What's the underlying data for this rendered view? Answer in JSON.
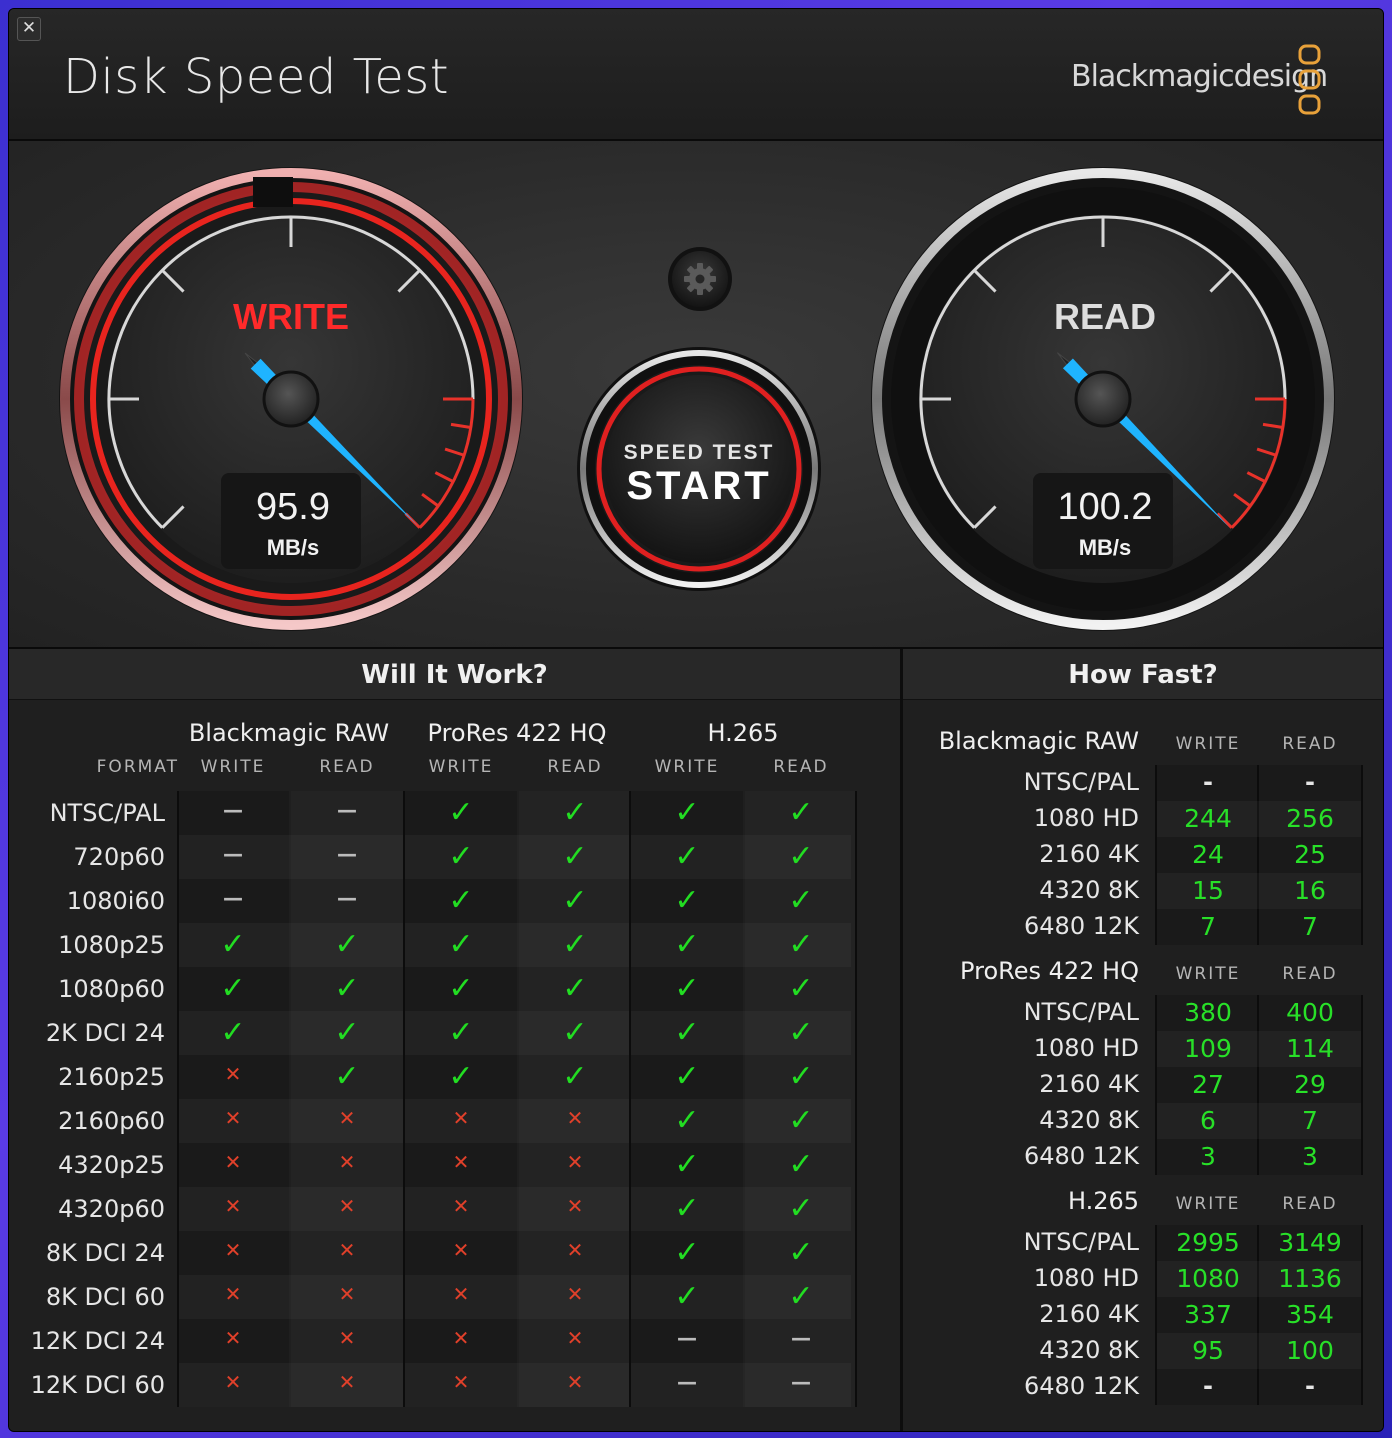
{
  "app": {
    "title": "Disk Speed Test",
    "brand": "Blackmagicdesign",
    "close_glyph": "✕"
  },
  "gauges": {
    "write": {
      "label": "WRITE",
      "value": "95.9",
      "unit": "MB/s",
      "speed_mbps": 95.9,
      "color": "#ff2a2a"
    },
    "read": {
      "label": "READ",
      "value": "100.2",
      "unit": "MB/s",
      "speed_mbps": 100.2,
      "color": "#d8d8d8"
    },
    "needle_color": "#1fb4ff",
    "settings_icon": "gear-icon"
  },
  "start_button": {
    "line1": "SPEED TEST",
    "line2": "START"
  },
  "will_it_work": {
    "title": "Will It Work?",
    "format_header": "FORMAT",
    "groups": [
      {
        "name": "Blackmagic RAW",
        "write": "WRITE",
        "read": "READ"
      },
      {
        "name": "ProRes 422 HQ",
        "write": "WRITE",
        "read": "READ"
      },
      {
        "name": "H.265",
        "write": "WRITE",
        "read": "READ"
      }
    ],
    "rows": [
      {
        "format": "NTSC/PAL",
        "cells": [
          "dash",
          "dash",
          "check",
          "check",
          "check",
          "check"
        ]
      },
      {
        "format": "720p60",
        "cells": [
          "dash",
          "dash",
          "check",
          "check",
          "check",
          "check"
        ]
      },
      {
        "format": "1080i60",
        "cells": [
          "dash",
          "dash",
          "check",
          "check",
          "check",
          "check"
        ]
      },
      {
        "format": "1080p25",
        "cells": [
          "check",
          "check",
          "check",
          "check",
          "check",
          "check"
        ]
      },
      {
        "format": "1080p60",
        "cells": [
          "check",
          "check",
          "check",
          "check",
          "check",
          "check"
        ]
      },
      {
        "format": "2K DCI 24",
        "cells": [
          "check",
          "check",
          "check",
          "check",
          "check",
          "check"
        ]
      },
      {
        "format": "2160p25",
        "cells": [
          "cross",
          "check",
          "check",
          "check",
          "check",
          "check"
        ]
      },
      {
        "format": "2160p60",
        "cells": [
          "cross",
          "cross",
          "cross",
          "cross",
          "check",
          "check"
        ]
      },
      {
        "format": "4320p25",
        "cells": [
          "cross",
          "cross",
          "cross",
          "cross",
          "check",
          "check"
        ]
      },
      {
        "format": "4320p60",
        "cells": [
          "cross",
          "cross",
          "cross",
          "cross",
          "check",
          "check"
        ]
      },
      {
        "format": "8K DCI 24",
        "cells": [
          "cross",
          "cross",
          "cross",
          "cross",
          "check",
          "check"
        ]
      },
      {
        "format": "8K DCI 60",
        "cells": [
          "cross",
          "cross",
          "cross",
          "cross",
          "check",
          "check"
        ]
      },
      {
        "format": "12K DCI 24",
        "cells": [
          "cross",
          "cross",
          "cross",
          "cross",
          "dash",
          "dash"
        ]
      },
      {
        "format": "12K DCI 60",
        "cells": [
          "cross",
          "cross",
          "cross",
          "cross",
          "dash",
          "dash"
        ]
      }
    ],
    "symbols": {
      "check": "✓",
      "cross": "✕",
      "dash": "—"
    },
    "colors": {
      "check": "#22dd22",
      "cross": "#e0402a",
      "dash": "#bcbcbc"
    }
  },
  "how_fast": {
    "title": "How Fast?",
    "sections": [
      {
        "name": "Blackmagic RAW",
        "write": "WRITE",
        "read": "READ",
        "rows": [
          {
            "format": "NTSC/PAL",
            "write": "-",
            "read": "-"
          },
          {
            "format": "1080 HD",
            "write": "244",
            "read": "256"
          },
          {
            "format": "2160 4K",
            "write": "24",
            "read": "25"
          },
          {
            "format": "4320 8K",
            "write": "15",
            "read": "16"
          },
          {
            "format": "6480 12K",
            "write": "7",
            "read": "7"
          }
        ]
      },
      {
        "name": "ProRes 422 HQ",
        "write": "WRITE",
        "read": "READ",
        "rows": [
          {
            "format": "NTSC/PAL",
            "write": "380",
            "read": "400"
          },
          {
            "format": "1080 HD",
            "write": "109",
            "read": "114"
          },
          {
            "format": "2160 4K",
            "write": "27",
            "read": "29"
          },
          {
            "format": "4320 8K",
            "write": "6",
            "read": "7"
          },
          {
            "format": "6480 12K",
            "write": "3",
            "read": "3"
          }
        ]
      },
      {
        "name": "H.265",
        "write": "WRITE",
        "read": "READ",
        "rows": [
          {
            "format": "NTSC/PAL",
            "write": "2995",
            "read": "3149"
          },
          {
            "format": "1080 HD",
            "write": "1080",
            "read": "1136"
          },
          {
            "format": "2160 4K",
            "write": "337",
            "read": "354"
          },
          {
            "format": "4320 8K",
            "write": "95",
            "read": "100"
          },
          {
            "format": "6480 12K",
            "write": "-",
            "read": "-"
          }
        ]
      }
    ]
  }
}
